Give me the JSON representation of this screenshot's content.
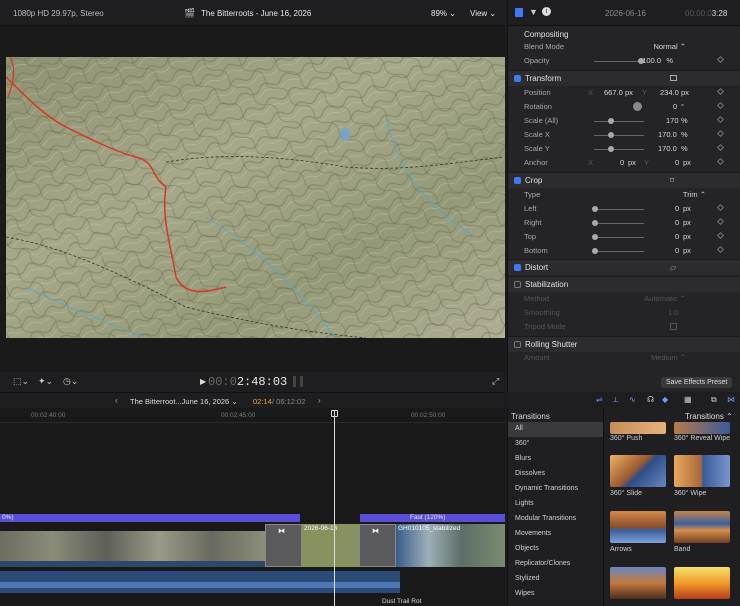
{
  "viewer": {
    "format": "1080p HD 29.97p, Stereo",
    "title": "The Bitterroots - June 16, 2026",
    "zoom": "89%",
    "view_label": "View",
    "timecode_dim": "00:0",
    "timecode": "2:48:03"
  },
  "inspector": {
    "date": "2026-06-16",
    "duration_dim": "00:00:0",
    "duration": "3:28",
    "compositing": "Compositing",
    "blend_mode_label": "Blend Mode",
    "blend_mode": "Normal",
    "opacity_label": "Opacity",
    "opacity": "100.0",
    "opacity_unit": "%",
    "transform": "Transform",
    "position_label": "Position",
    "pos_x_label": "X",
    "pos_x": "667.0",
    "pos_y_label": "Y",
    "pos_y": "234.0",
    "px": "px",
    "rotation_label": "Rotation",
    "rotation": "0",
    "deg": "°",
    "scale_all_label": "Scale (All)",
    "scale_all": "170",
    "scale_x_label": "Scale X",
    "scale_x": "170.0",
    "scale_y_label": "Scale Y",
    "scale_y": "170.0",
    "pct": "%",
    "anchor_label": "Anchor",
    "anchor_x": "0",
    "anchor_y": "0",
    "crop": "Crop",
    "type_label": "Type",
    "type_value": "Trim",
    "left_label": "Left",
    "right_label": "Right",
    "top_label": "Top",
    "bottom_label": "Bottom",
    "zero": "0",
    "distort": "Distort",
    "stabilization": "Stabilization",
    "method_label": "Method",
    "method": "Automatic",
    "smoothing_label": "Smoothing",
    "smoothing": "1.0",
    "tripod_label": "Tripod Mode",
    "rolling": "Rolling Shutter",
    "amount_label": "Amount",
    "amount": "Medium",
    "save_preset": "Save Effects Preset"
  },
  "timeline": {
    "project": "The Bitterroot...June 16, 2026",
    "position": "02:14",
    "duration": "06:12:02",
    "ruler": [
      "00:02:40:00",
      "00:02:45:00",
      "00:02:50:00"
    ],
    "speed_left": "0%)",
    "speed_right": "Fast (120%)",
    "clip_date": "2026-06-16",
    "clip_name": "GH010105_stabilized",
    "audio_name": "Dust Trail Rot"
  },
  "transitions": {
    "header": "Transitions",
    "browser_title": "Transitions",
    "categories": [
      "All",
      "360°",
      "Blurs",
      "Dissolves",
      "Dynamic Transitions",
      "Lights",
      "Modular Transitions",
      "Movements",
      "Objects",
      "Replicator/Clones",
      "Stylized",
      "Wipes"
    ],
    "thumbs": [
      "360° Push",
      "360° Reveal Wipe",
      "360° Slide",
      "360° Wipe",
      "Arrows",
      "Band"
    ]
  }
}
